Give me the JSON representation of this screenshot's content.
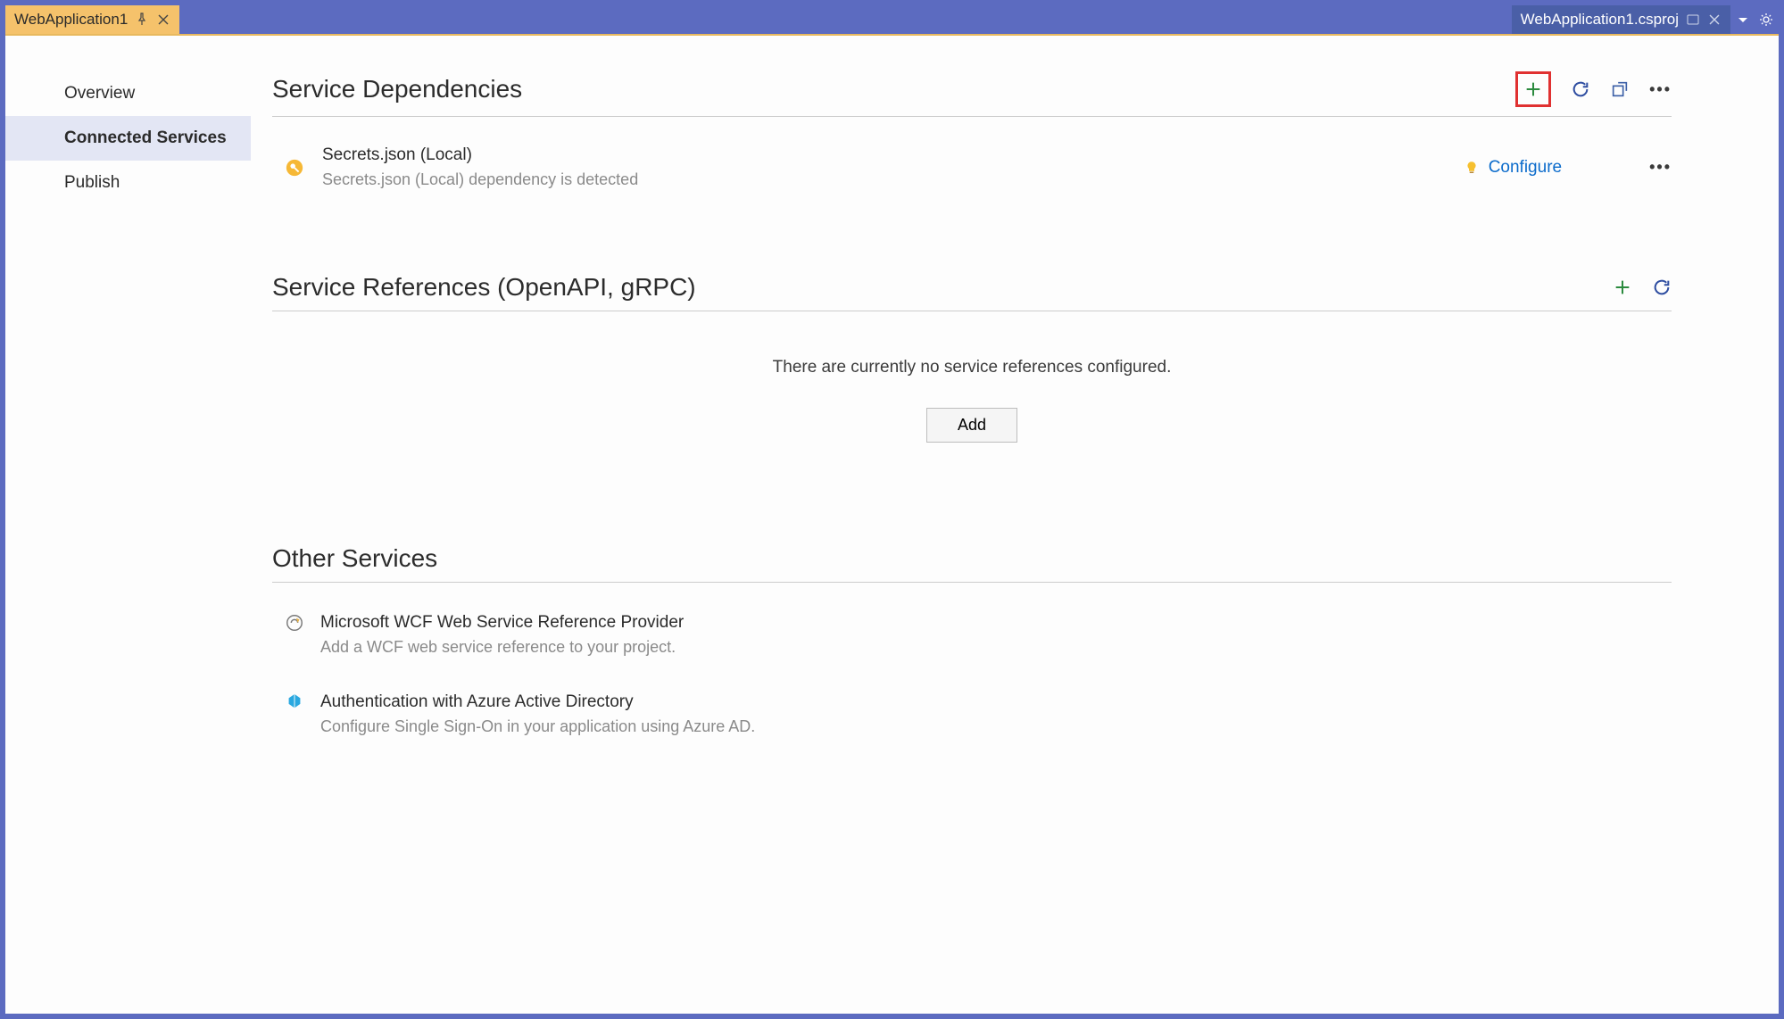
{
  "tabs": {
    "left": {
      "label": "WebApplication1"
    },
    "right": {
      "label": "WebApplication1.csproj"
    }
  },
  "sidebar": {
    "items": [
      {
        "label": "Overview"
      },
      {
        "label": "Connected Services"
      },
      {
        "label": "Publish"
      }
    ]
  },
  "sections": {
    "dependencies": {
      "title": "Service Dependencies",
      "configure_label": "Configure",
      "item": {
        "title": "Secrets.json (Local)",
        "description": "Secrets.json (Local) dependency is detected"
      }
    },
    "references": {
      "title": "Service References (OpenAPI, gRPC)",
      "empty_text": "There are currently no service references configured.",
      "add_label": "Add"
    },
    "other": {
      "title": "Other Services",
      "items": [
        {
          "title": "Microsoft WCF Web Service Reference Provider",
          "description": "Add a WCF web service reference to your project."
        },
        {
          "title": "Authentication with Azure Active Directory",
          "description": "Configure Single Sign-On in your application using Azure AD."
        }
      ]
    }
  },
  "colors": {
    "accent_blue": "#0b6bcb",
    "frame": "#5c6bc0",
    "active_tab": "#f5c26b",
    "selected_nav": "#e3e6f4",
    "highlight_red": "#e03131"
  }
}
